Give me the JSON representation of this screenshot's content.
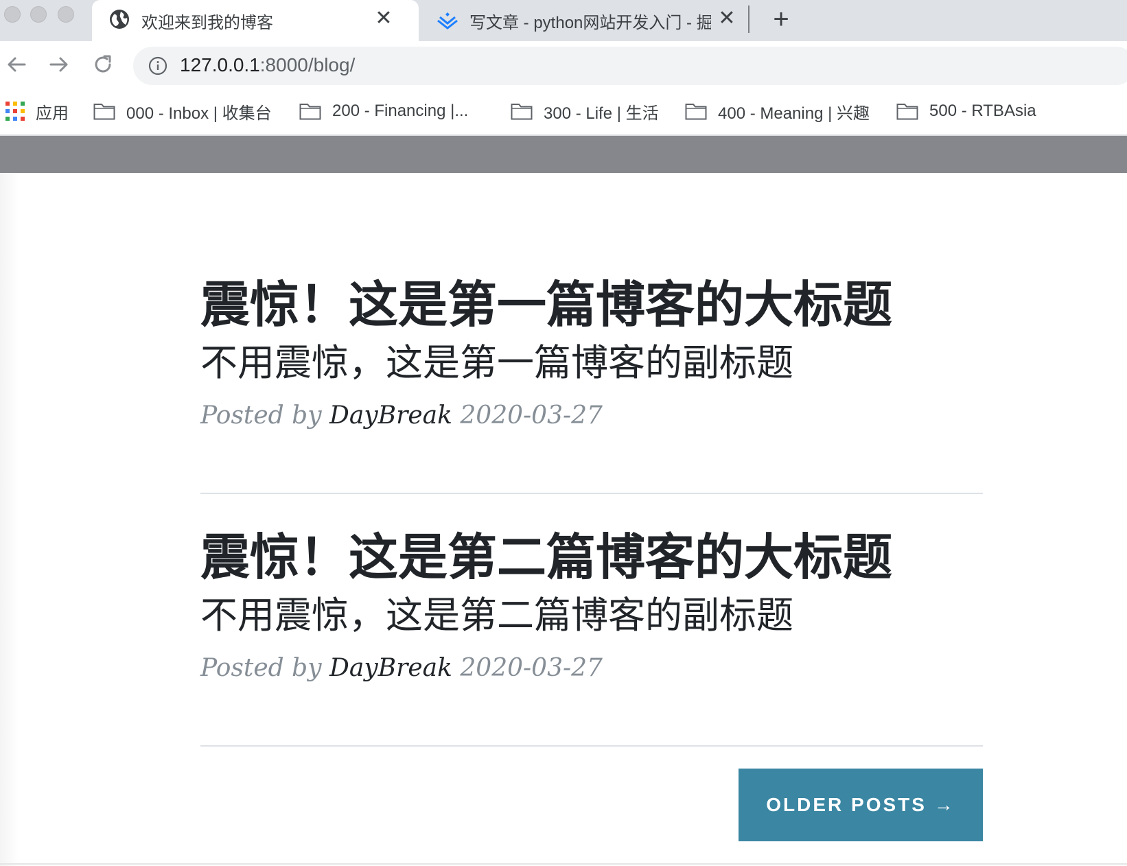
{
  "browser": {
    "tabs": [
      {
        "title": "欢迎来到我的博客",
        "icon": "globe-icon",
        "active": true
      },
      {
        "title": "写文章 - python网站开发入门 - 掘",
        "icon": "juejin-icon",
        "active": false
      }
    ],
    "close_symbol": "✕",
    "newtab_symbol": "+",
    "url_host": "127.0.0.1",
    "url_rest": ":8000/blog/"
  },
  "bookmarks": {
    "apps_label": "应用",
    "items": [
      {
        "label": "000 - Inbox | 收集台"
      },
      {
        "label": "200 - Financing |..."
      },
      {
        "label": "300 - Life | 生活"
      },
      {
        "label": "400 - Meaning | 兴趣"
      },
      {
        "label": "500 - RTBAsia"
      }
    ]
  },
  "posts": [
    {
      "title": "震惊！这是第一篇博客的大标题",
      "subtitle": "不用震惊，这是第一篇博客的副标题",
      "meta_prefix": "Posted by",
      "author": "DayBreak",
      "date": "2020-03-27"
    },
    {
      "title": "震惊！这是第二篇博客的大标题",
      "subtitle": "不用震惊，这是第二篇博客的副标题",
      "meta_prefix": "Posted by",
      "author": "DayBreak",
      "date": "2020-03-27"
    }
  ],
  "pager": {
    "older_label": "Older Posts →"
  },
  "colors": {
    "header_band": "#85878c",
    "button": "#3a86a3",
    "meta_gray": "#868e96"
  }
}
